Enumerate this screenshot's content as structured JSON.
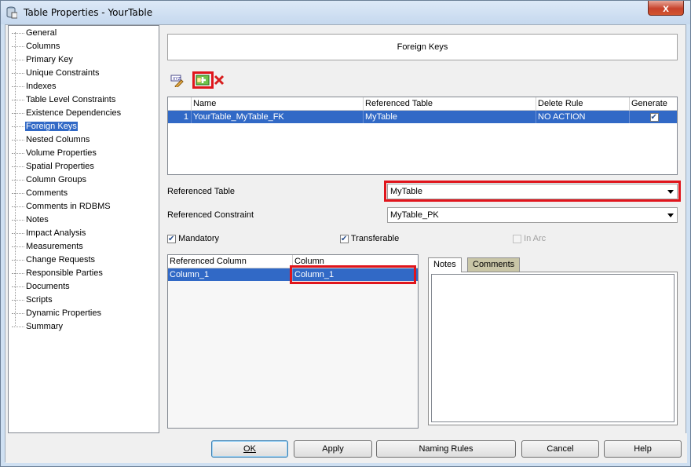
{
  "window": {
    "title": "Table Properties - YourTable",
    "close_glyph": "x"
  },
  "nav": {
    "items": [
      "General",
      "Columns",
      "Primary Key",
      "Unique Constraints",
      "Indexes",
      "Table Level Constraints",
      "Existence Dependencies",
      "Foreign Keys",
      "Nested Columns",
      "Volume Properties",
      "Spatial Properties",
      "Column Groups",
      "Comments",
      "Comments in RDBMS",
      "Notes",
      "Impact Analysis",
      "Measurements",
      "Change Requests",
      "Responsible Parties",
      "Documents",
      "Scripts",
      "Dynamic Properties",
      "Summary"
    ],
    "selected_index": 7
  },
  "panel": {
    "header": "Foreign Keys"
  },
  "toolbar": {
    "icons": [
      "properties-icon",
      "add-icon",
      "delete-icon"
    ]
  },
  "fk_table": {
    "columns": [
      "Name",
      "Referenced Table",
      "Delete Rule",
      "Generate"
    ],
    "rows": [
      {
        "num": "1",
        "name": "YourTable_MyTable_FK",
        "ref_table": "MyTable",
        "delete_rule": "NO ACTION",
        "generate": true
      }
    ]
  },
  "form": {
    "ref_table_label": "Referenced Table",
    "ref_table_value": "MyTable",
    "ref_constraint_label": "Referenced Constraint",
    "ref_constraint_value": "MyTable_PK",
    "mandatory_label": "Mandatory",
    "mandatory": true,
    "transferable_label": "Transferable",
    "transferable": true,
    "inarc_label": "In Arc",
    "inarc": false
  },
  "col_table": {
    "headers": [
      "Referenced Column",
      "Column"
    ],
    "rows": [
      {
        "ref": "Column_1",
        "col": "Column_1"
      }
    ]
  },
  "tabs": [
    "Notes",
    "Comments"
  ],
  "buttons": {
    "ok": "OK",
    "apply": "Apply",
    "naming": "Naming Rules",
    "cancel": "Cancel",
    "help": "Help"
  },
  "colors": {
    "selection": "#3169c6",
    "highlight": "#e0151c"
  }
}
